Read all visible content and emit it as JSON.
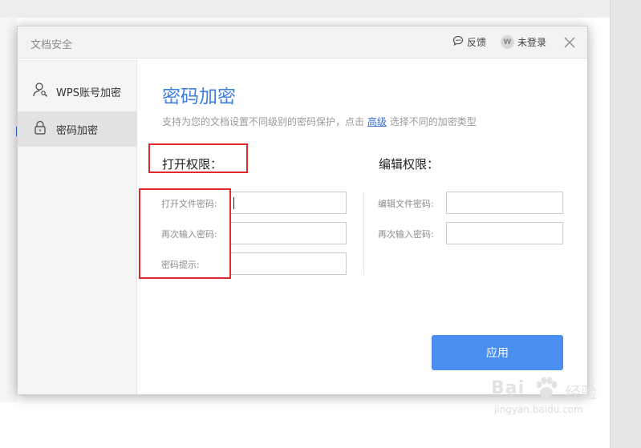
{
  "dialog": {
    "title": "文档安全",
    "feedback_label": "反馈",
    "login_label": "未登录",
    "avatar_letter": "W"
  },
  "sidebar": {
    "items": [
      {
        "label": "WPS账号加密",
        "icon": "user-key-icon",
        "active": false
      },
      {
        "label": "密码加密",
        "icon": "lock-icon",
        "active": true
      }
    ]
  },
  "main": {
    "title": "密码加密",
    "subtitle_before": "支持为您的文档设置不同级别的密码保护，点击",
    "subtitle_link": "高级",
    "subtitle_after": "选择不同的加密类型"
  },
  "open_permission": {
    "heading": "打开权限：",
    "fields": [
      {
        "label": "打开文件密码:",
        "value": ""
      },
      {
        "label": "再次输入密码:",
        "value": ""
      },
      {
        "label": "密码提示:",
        "value": ""
      }
    ]
  },
  "edit_permission": {
    "heading": "编辑权限：",
    "fields": [
      {
        "label": "编辑文件密码:",
        "value": ""
      },
      {
        "label": "再次输入密码:",
        "value": ""
      }
    ]
  },
  "apply_button": "应用",
  "watermark": {
    "brand": "Bai",
    "brand_cn": "经验",
    "url": "jingyan.baidu.com"
  },
  "colors": {
    "accent": "#3d7fe0",
    "button": "#4a8ef0",
    "highlight": "#e02a2a"
  }
}
